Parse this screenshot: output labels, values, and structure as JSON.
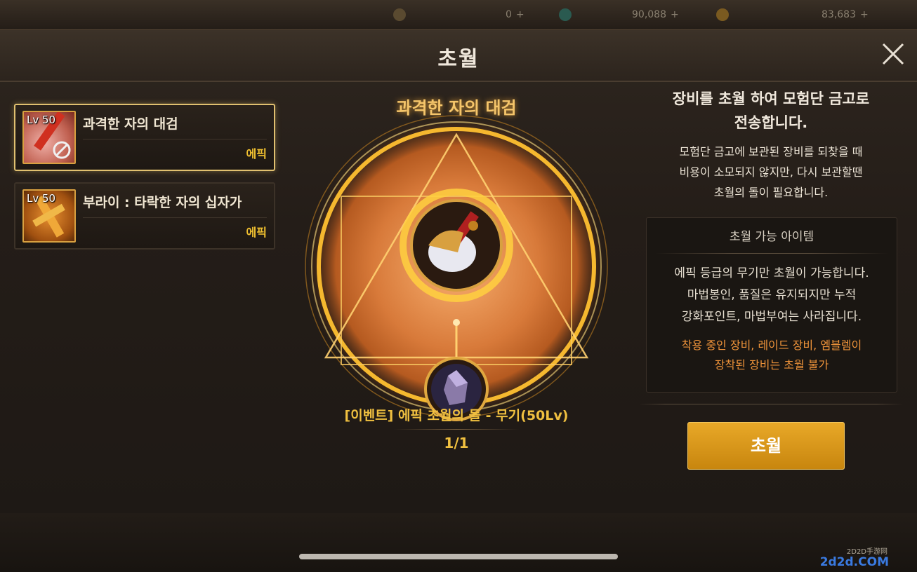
{
  "topbar": {
    "resources": [
      {
        "icon": "moon-icon",
        "value": "0"
      },
      {
        "icon": "gem-icon",
        "value": "90,088"
      },
      {
        "icon": "gold-icon",
        "value": "83,683"
      }
    ]
  },
  "modal": {
    "title": "초월",
    "close_icon": "close-icon"
  },
  "items": [
    {
      "level": "Lv 50",
      "name": "과격한 자의 대검",
      "grade": "에픽",
      "selected": true
    },
    {
      "level": "Lv 50",
      "name": "부라이 : 타락한 자의 십자가",
      "grade": "에픽",
      "selected": false
    }
  ],
  "center": {
    "item_name": "과격한 자의 대검",
    "stone_name": "[이벤트] 에픽 초월의 돌 - 무기(50Lv)",
    "stone_count": "1/1"
  },
  "info": {
    "title": "장비를 초월 하여 모험단 금고로\n전송합니다.",
    "subtitle": "모험단 금고에 보관된 장비를 되찾을 때\n비용이 소모되지 않지만, 다시 보관할땐\n초월의 돌이 필요합니다.",
    "box_title": "초월 가능 아이템",
    "box_body": "에픽 등급의 무기만 초월이 가능합니다.\n마법봉인, 품질은 유지되지만 누적\n강화포인트, 마법부여는 사라집니다.",
    "box_warning": "착용 중인 장비, 레이드 장비, 엠블렘이\n장착된 장비는 초월 불가"
  },
  "buttons": {
    "transcend": "초월"
  },
  "watermark": {
    "text": "2d2d.COM",
    "sub": "2D2D手游网"
  },
  "colors": {
    "accent_gold": "#f0c040",
    "warning_orange": "#f0943a",
    "button_gold": "#e8a828"
  }
}
